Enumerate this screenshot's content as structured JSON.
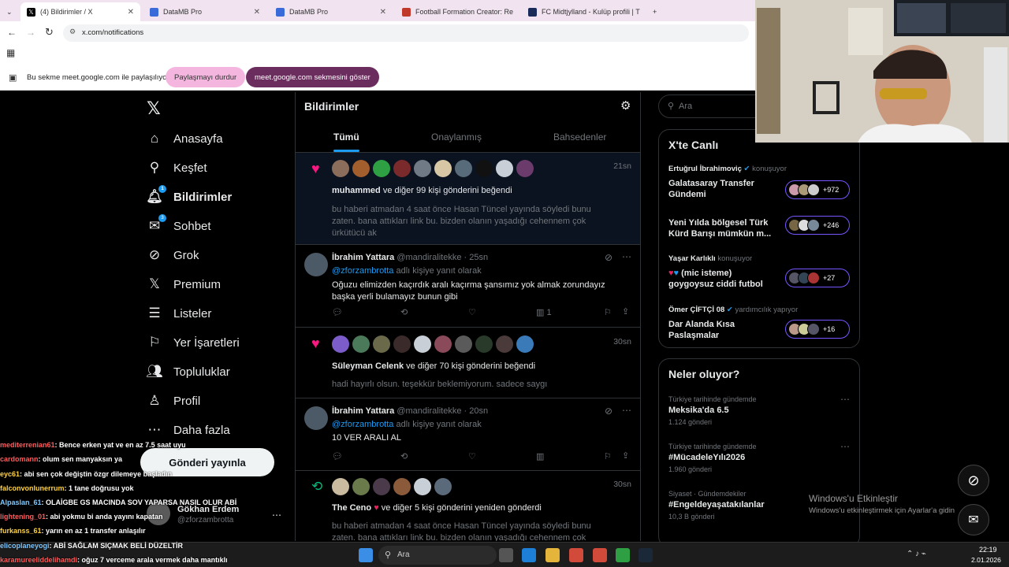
{
  "browser": {
    "tabs": [
      {
        "title": "(4) Bildirimler / X",
        "active": true
      },
      {
        "title": "DataMB Pro"
      },
      {
        "title": "DataMB Pro"
      },
      {
        "title": "Football Formation Creator: Re"
      },
      {
        "title": "FC Midtjylland - Kulüp profili | T"
      }
    ],
    "url": "x.com/notifications",
    "share_text": "Bu sekme meet.google.com ile paylaşılıyor",
    "stop_sharing": "Paylaşmayı durdur",
    "show_tab": "meet.google.com sekmesini göster"
  },
  "nav": {
    "items": [
      {
        "label": "Anasayfa",
        "icon": "home-icon"
      },
      {
        "label": "Keşfet",
        "icon": "search-icon"
      },
      {
        "label": "Bildirimler",
        "icon": "bell-icon",
        "badge": "1"
      },
      {
        "label": "Sohbet",
        "icon": "mail-icon",
        "badge": "3"
      },
      {
        "label": "Grok",
        "icon": "grok-icon"
      },
      {
        "label": "Premium",
        "icon": "x-icon"
      },
      {
        "label": "Listeler",
        "icon": "list-icon"
      },
      {
        "label": "Yer İşaretleri",
        "icon": "bookmark-icon"
      },
      {
        "label": "Topluluklar",
        "icon": "people-icon"
      },
      {
        "label": "Profil",
        "icon": "person-icon"
      },
      {
        "label": "Daha fazla",
        "icon": "more-icon"
      }
    ],
    "post_button": "Gönderi yayınla",
    "account": {
      "name": "Gökhan Erdem",
      "handle": "@zforzambrotta"
    }
  },
  "notifications": {
    "title": "Bildirimler",
    "tabs": [
      "Tümü",
      "Onaylanmış",
      "Bahsedenler"
    ],
    "items": [
      {
        "type": "like",
        "who": "muhammed",
        "rest": "ve diğer 99 kişi gönderini beğendi",
        "time": "21sn",
        "text": "bu haberi atmadan 4 saat önce Hasan Tüncel yayında söyledi bunu zaten. bana attıkları link bu. bizden olanın yaşadığı cehennem çok ürkütücü ak"
      },
      {
        "type": "reply",
        "name": "İbrahim Yattara",
        "handle": "@mandiralitekke",
        "time": "25sn",
        "reply_to": "@zforzambrotta",
        "reply_suffix": "adlı kişiye yanıt olarak",
        "text": "Oğuzu elimizden kaçırdık aralı kaçırma şansımız yok almak zorundayız başka yerli bulamayız bunun gibi",
        "views": "1"
      },
      {
        "type": "like",
        "who": "Süleyman Celenk",
        "rest": "ve diğer 70 kişi gönderini beğendi",
        "time": "30sn",
        "text": "hadi hayırlı olsun. teşekkür beklemiyorum. sadece saygı"
      },
      {
        "type": "reply",
        "name": "İbrahim Yattara",
        "handle": "@mandiralitekke",
        "time": "20sn",
        "reply_to": "@zforzambrotta",
        "reply_suffix": "adlı kişiye yanıt olarak",
        "text": "10 VER ARALI AL"
      },
      {
        "type": "repost",
        "who": "The Ceno",
        "rest": "ve diğer 5 kişi gönderini yeniden gönderdi",
        "time": "30sn",
        "text": "bu haberi atmadan 4 saat önce Hasan Tüncel yayında söyledi bunu zaten. bana attıkları link bu. bizden olanın yaşadığı cehennem çok"
      }
    ]
  },
  "sidebar": {
    "search_placeholder": "Ara",
    "live_title": "X'te Canlı",
    "live": [
      {
        "host": "Ertuğrul İbrahimoviç",
        "status": "konuşuyor",
        "title": "Galatasaray Transfer Gündemi",
        "count": "+972"
      },
      {
        "host": "",
        "status": "",
        "title": "Yeni Yılda bölgesel Türk Kürd Barışı mümkün m...",
        "count": "+246"
      },
      {
        "host": "Yaşar Karlıklı",
        "status": "konuşuyor",
        "title": "(mic isteme) goygoysuz ciddi futbol",
        "count": "+27"
      },
      {
        "host": "Ömer ÇİFTÇİ 08",
        "status": "yardımcılık yapıyor",
        "title": "Dar Alanda Kısa Paslaşmalar",
        "count": "+16"
      }
    ],
    "trends_title": "Neler oluyor?",
    "trends": [
      {
        "context": "Türkiye tarihinde gündemde",
        "name": "Meksika'da 6.5",
        "posts": "1.124 gönderi"
      },
      {
        "context": "Türkiye tarihinde gündemde",
        "name": "#MücadeleYılı2026",
        "posts": "1.960 gönderi"
      },
      {
        "context": "Siyaset · Gündemdekiler",
        "name": "#Engeldeyaşatakılanlar",
        "posts": "10,3 B gönderi"
      }
    ],
    "windows_activate": "Windows'u Etkinleştir",
    "windows_activate_sub": "Windows'u etkinleştirmek için Ayarlar'a gidin"
  },
  "chat": [
    {
      "user": "mediterrenian61",
      "msg": ": Bence erken yat ve en az 7.5 saat uyu",
      "color": "#ff5a5a"
    },
    {
      "user": "cardomann",
      "msg": ": olum sen manyaksın ya",
      "color": "#ff5a5a"
    },
    {
      "user": "eyc61",
      "msg": ": abi sen çok değiştin özgr dilemeye başladın",
      "color": "#ffd23f"
    },
    {
      "user": "falconvonlunerrum",
      "msg": ": 1 tane doğrusu yok",
      "color": "#ffd23f"
    },
    {
      "user": "Alpaslan_61",
      "msg": ": OLAİGBE GS MACINDA SOV YAPARSA NASIL OLUR ABİ",
      "color": "#7ec8ff"
    },
    {
      "user": "lightening_01",
      "msg": ": abi yokmu bi anda yayını kapatan",
      "color": "#ff5a5a"
    },
    {
      "user": "furkanss_61",
      "msg": ": yarın en az 1 transfer anlaşılır",
      "color": "#ffd23f"
    },
    {
      "user": "elicoplaneyogi",
      "msg": ": ABİ SAĞLAM SIÇMAK BELİ DÜZELTİR",
      "color": "#7ec8ff"
    },
    {
      "user": "karamureeliddelihamdi",
      "msg": ": oğuz 7 verceme arala vermek daha mantıklı",
      "color": "#ff5a5a"
    }
  ],
  "taskbar": {
    "search": "Ara",
    "time": "22:19",
    "date": "2.01.2026"
  }
}
